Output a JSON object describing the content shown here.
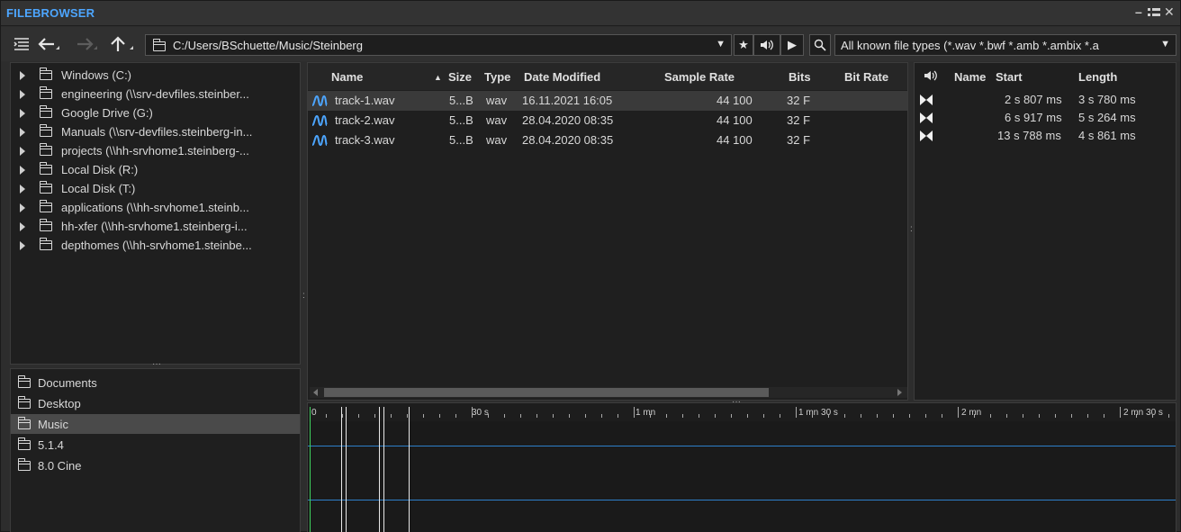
{
  "app": {
    "title": "FILEBROWSER"
  },
  "window_controls": {
    "minimize": "–",
    "dock": "▪▪",
    "close": "✕"
  },
  "toolbar": {
    "path": "C:/Users/BSchuette/Music/Steinberg",
    "filter": "All known file types (*.wav *.bwf *.amb *.ambix *.a"
  },
  "tree": {
    "items": [
      {
        "label": "Windows (C:)"
      },
      {
        "label": "engineering (\\\\srv-devfiles.steinber..."
      },
      {
        "label": "Google Drive (G:)"
      },
      {
        "label": "Manuals (\\\\srv-devfiles.steinberg-in..."
      },
      {
        "label": "projects (\\\\hh-srvhome1.steinberg-..."
      },
      {
        "label": "Local Disk (R:)"
      },
      {
        "label": "Local Disk (T:)"
      },
      {
        "label": "applications (\\\\hh-srvhome1.steinb..."
      },
      {
        "label": "hh-xfer (\\\\hh-srvhome1.steinberg-i..."
      },
      {
        "label": "depthomes (\\\\hh-srvhome1.steinbe..."
      }
    ]
  },
  "favorites": {
    "items": [
      {
        "label": "Documents",
        "selected": false
      },
      {
        "label": "Desktop",
        "selected": false
      },
      {
        "label": "Music",
        "selected": true
      },
      {
        "label": "5.1.4",
        "selected": false
      },
      {
        "label": "8.0 Cine",
        "selected": false
      }
    ]
  },
  "files": {
    "columns": {
      "name": "Name",
      "size": "Size",
      "type": "Type",
      "date": "Date Modified",
      "rate": "Sample Rate",
      "bits": "Bits",
      "bitrate": "Bit Rate"
    },
    "rows": [
      {
        "name": "track-1.wav",
        "size": "5...B",
        "type": "wav",
        "date": "16.11.2021 16:05",
        "rate": "44 100",
        "bits": "32 F",
        "selected": true
      },
      {
        "name": "track-2.wav",
        "size": "5...B",
        "type": "wav",
        "date": "28.04.2020 08:35",
        "rate": "44 100",
        "bits": "32 F",
        "selected": false
      },
      {
        "name": "track-3.wav",
        "size": "5...B",
        "type": "wav",
        "date": "28.04.2020 08:35",
        "rate": "44 100",
        "bits": "32 F",
        "selected": false
      }
    ]
  },
  "markers": {
    "columns": {
      "name": "Name",
      "start": "Start",
      "length": "Length"
    },
    "rows": [
      {
        "start": "2 s 807 ms",
        "length": "3 s 780 ms"
      },
      {
        "start": "6 s 917 ms",
        "length": "5 s 264 ms"
      },
      {
        "start": "13 s 788 ms",
        "length": "4 s 861 ms"
      }
    ]
  },
  "timeline": {
    "labels": [
      "0",
      "30 s",
      "1 mn",
      "1 mn 30 s",
      "2 mn",
      "2 mn 30 s"
    ]
  },
  "colors": {
    "title": "#4da6ff",
    "waveform_line": "#2d7fc9",
    "cursor": "#3fd35f",
    "wave_icon": "#4da6ff"
  }
}
